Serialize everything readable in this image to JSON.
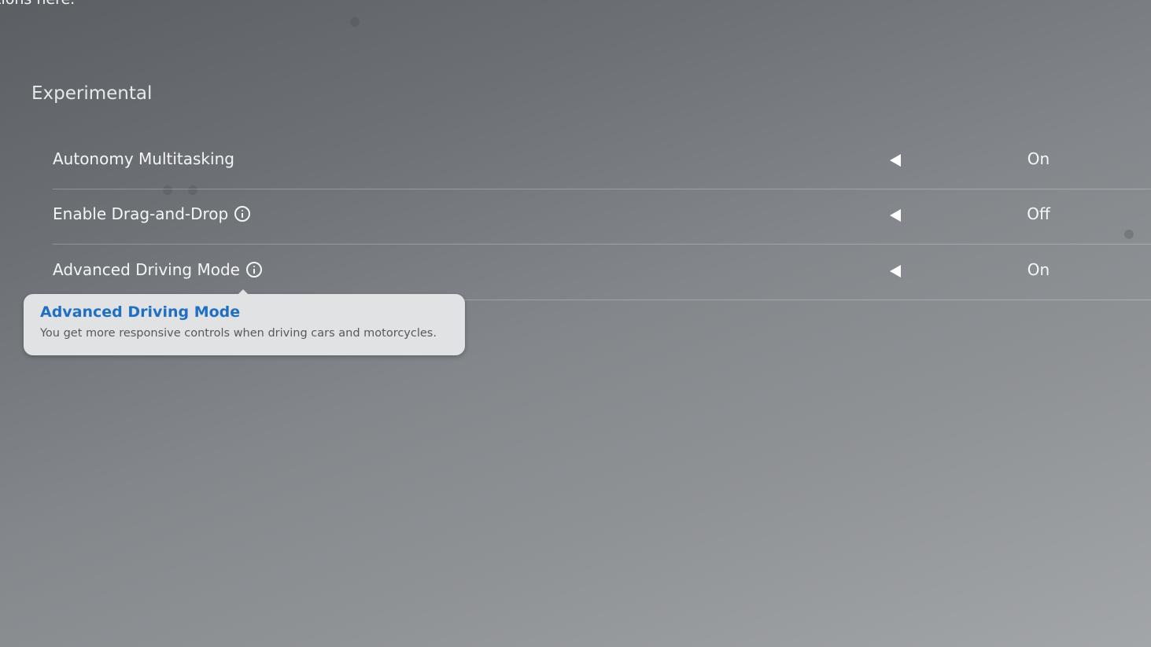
{
  "header": {
    "clipped_text": "tions here."
  },
  "section": {
    "title": "Experimental"
  },
  "settings": [
    {
      "label": "Autonomy Multitasking",
      "value": "On",
      "has_info": false
    },
    {
      "label": "Enable Drag-and-Drop",
      "value": "Off",
      "has_info": true
    },
    {
      "label": "Advanced Driving Mode",
      "value": "On",
      "has_info": true
    }
  ],
  "tooltip": {
    "title": "Advanced Driving Mode",
    "body": "You get more responsive controls when driving cars and motorcycles."
  },
  "icons": {
    "info": "info-icon",
    "previous": "arrow-left-icon"
  },
  "colors": {
    "tooltip_title": "#1f6fc4",
    "tooltip_background": "#e1e2e3"
  }
}
